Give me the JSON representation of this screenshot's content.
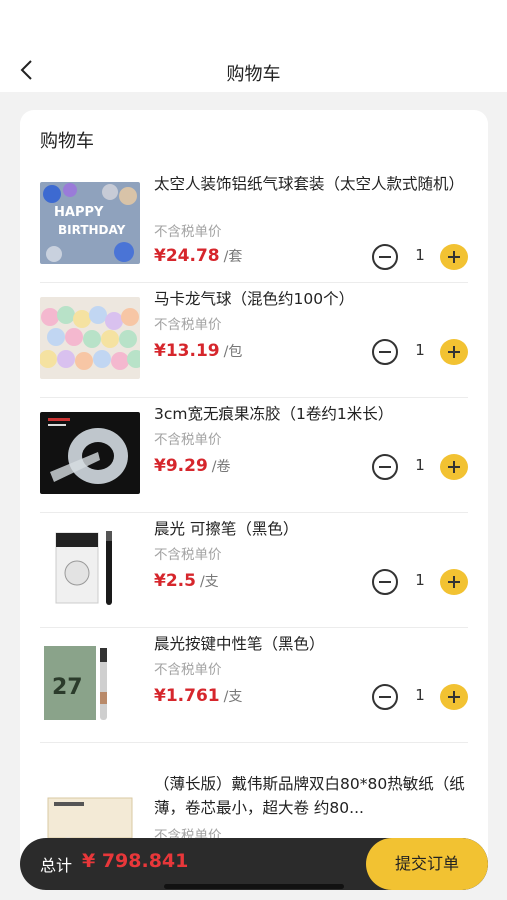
{
  "header": {
    "title": "购物车",
    "back_icon": "chevron-left-icon"
  },
  "cart": {
    "title": "购物车",
    "tax_label": "不含税单价",
    "items": [
      {
        "name": "太空人装饰铝纸气球套装（太空人款式随机）",
        "price": "¥24.78",
        "unit": "/套",
        "qty": "1",
        "image": "birthday-balloons-image"
      },
      {
        "name": "马卡龙气球（混色约100个）",
        "price": "¥13.19",
        "unit": "/包",
        "qty": "1",
        "image": "macaron-balloons-image"
      },
      {
        "name": "3cm宽无痕果冻胶（1卷约1米长）",
        "price": "¥9.29",
        "unit": "/卷",
        "qty": "1",
        "image": "tape-roll-image"
      },
      {
        "name": "晨光 可擦笔（黑色）",
        "price": "¥2.5",
        "unit": "/支",
        "qty": "1",
        "image": "erasable-pen-image"
      },
      {
        "name": "晨光按键中性笔（黑色）",
        "price": "¥1.761",
        "unit": "/支",
        "qty": "1",
        "image": "gel-pen-image"
      },
      {
        "name": "（薄长版）戴伟斯品牌双白80*80热敏纸（纸薄，卷芯最小，超大卷 约80...",
        "price": "",
        "unit": "",
        "qty": "",
        "image": "thermal-paper-image"
      }
    ]
  },
  "footer": {
    "total_label": "总计",
    "total_amount": "¥ 798.841",
    "submit_label": "提交订单"
  },
  "colors": {
    "accent": "#f2c232",
    "price": "#d6262c",
    "footer_bg": "#2b2b2b"
  }
}
